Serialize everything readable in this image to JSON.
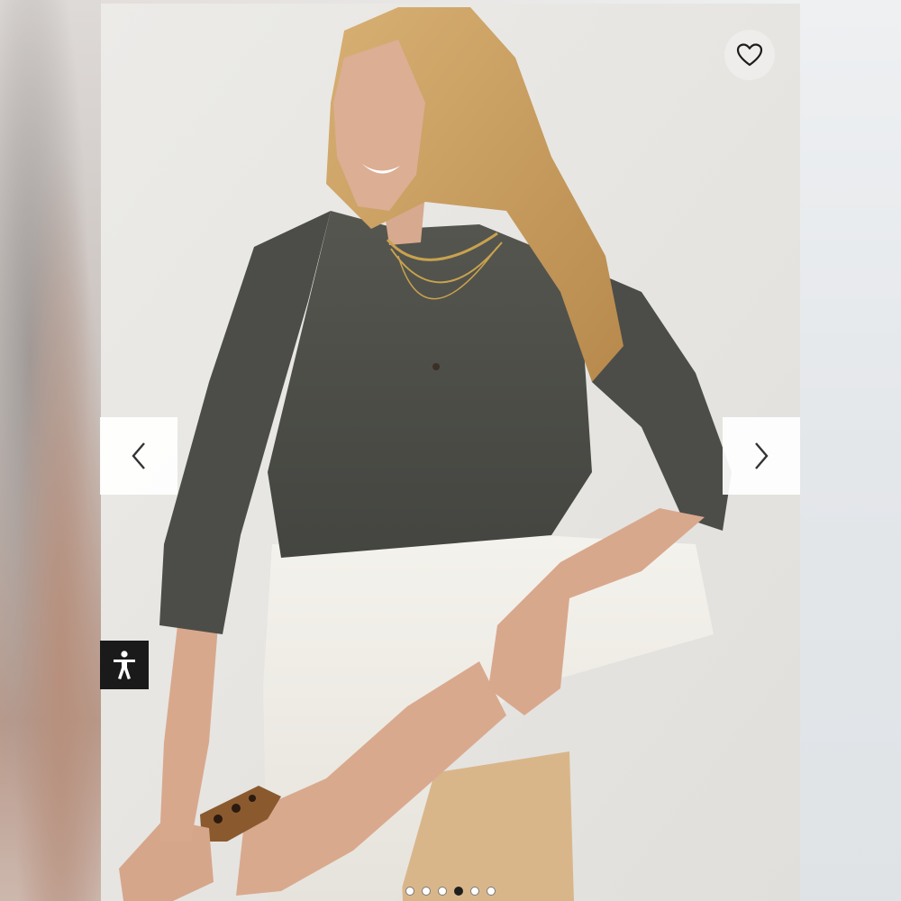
{
  "gallery": {
    "photo": {
      "icon": "product-photo-model-gray-sweater",
      "colors": {
        "sweater": "#4a4b49",
        "pants": "#f2f0ea",
        "hair": "#c99a5a",
        "stool": "#d9b68a"
      }
    },
    "wishlist": {
      "icon": "heart-outline-icon"
    },
    "prev": {
      "icon": "chevron-left-icon"
    },
    "next": {
      "icon": "chevron-right-icon"
    },
    "pagination": {
      "count": 6,
      "active_index": 3
    }
  },
  "accessibility": {
    "icon": "accessibility-person-icon"
  },
  "colors": {
    "a11y_bg": "#1a1a1a",
    "arrow_bg": "#ffffff",
    "dot_active": "#1f1f1f"
  }
}
